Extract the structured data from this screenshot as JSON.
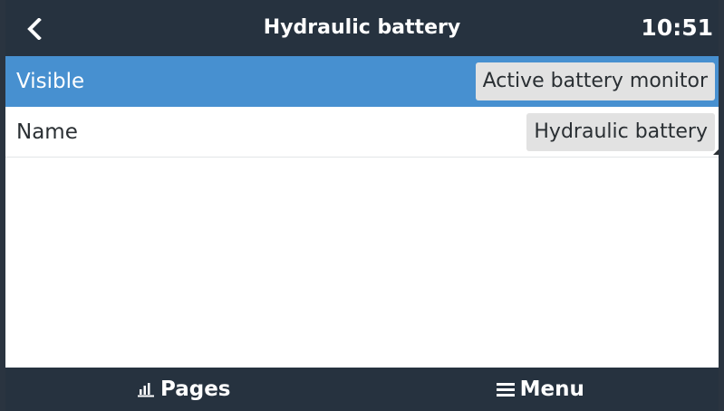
{
  "header": {
    "title": "Hydraulic battery",
    "clock": "10:51",
    "back_icon": "chevron-left-icon"
  },
  "rows": [
    {
      "label": "Visible",
      "value": "Active battery monitor",
      "selected": true
    },
    {
      "label": "Name",
      "value": "Hydraulic battery",
      "selected": false
    }
  ],
  "footer": {
    "pages_label": "Pages",
    "pages_icon": "bar-chart-icon",
    "menu_label": "Menu",
    "menu_icon": "hamburger-menu-icon"
  },
  "colors": {
    "header_bg": "#26323f",
    "selected_row_bg": "#4790d0",
    "value_box_bg": "#e2e2e2"
  }
}
